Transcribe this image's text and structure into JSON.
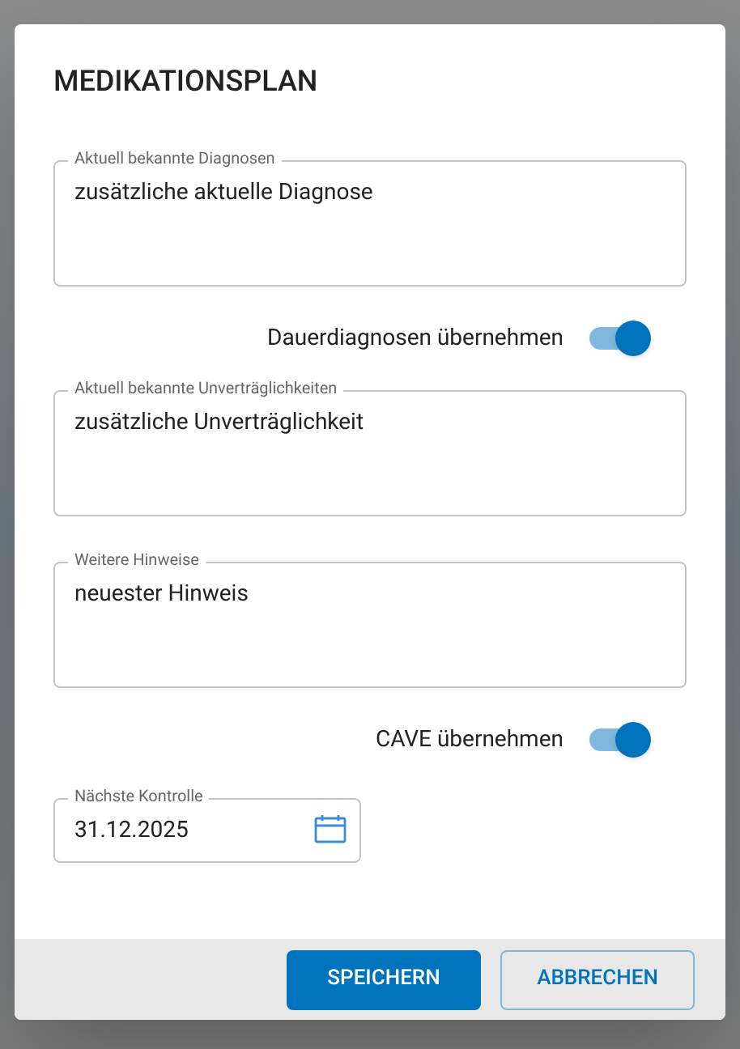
{
  "dialog": {
    "title": "MEDIKATIONSPLAN",
    "items": [
      {
        "kind": "textarea",
        "label": "Aktuell bekannte Diagnosen",
        "value": "zusätzliche aktuelle Diagnose"
      },
      {
        "kind": "toggle",
        "label": "Dauerdiagnosen übernehmen",
        "on": true
      },
      {
        "kind": "textarea",
        "label": "Aktuell bekannte Unverträglichkeiten",
        "value": "zusätzliche Unverträglichkeit"
      },
      {
        "kind": "textarea",
        "label": "Weitere Hinweise",
        "value": "neuester Hinweis"
      },
      {
        "kind": "toggle",
        "label": "CAVE übernehmen",
        "on": true
      },
      {
        "kind": "date",
        "label": "Nächste Kontrolle",
        "value": "31.12.2025"
      }
    ],
    "buttons": [
      {
        "label": "SPEICHERN",
        "primary": true
      },
      {
        "label": "ABBRECHEN",
        "primary": false
      }
    ]
  }
}
